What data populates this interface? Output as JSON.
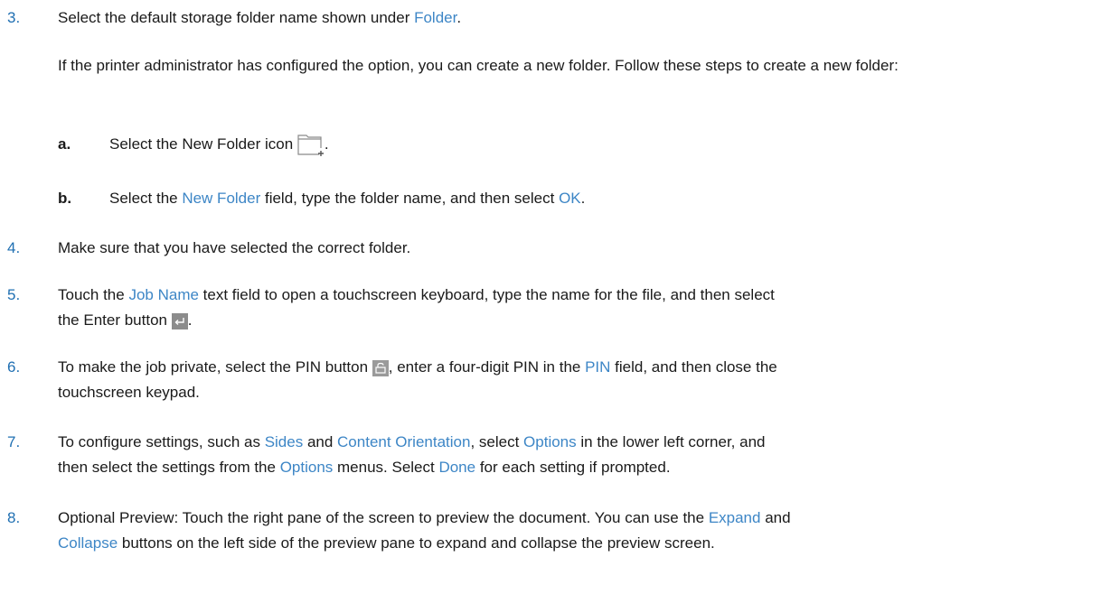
{
  "steps": [
    {
      "number": "3.",
      "parts": {
        "p1": "Select the default storage folder name shown under ",
        "u1": "Folder",
        "p2": "."
      }
    },
    {
      "paragraph": "If the printer administrator has configured the option, you can create a new folder. Follow these steps to create a new folder:"
    },
    {
      "letter": "a.",
      "parts": {
        "p1": "Select the New Folder icon ",
        "p2": "."
      },
      "icon": "new-folder-icon"
    },
    {
      "letter": "b.",
      "parts": {
        "p1": "Select the ",
        "u1": "New Folder",
        "p2": " field, type the folder name, and then select ",
        "u2": "OK",
        "p3": "."
      }
    },
    {
      "number": "4.",
      "parts": {
        "p1": "Make sure that you have selected the correct folder."
      }
    },
    {
      "number": "5.",
      "parts": {
        "p1": "Touch the ",
        "u1": "Job Name",
        "p2": " text field to open a touchscreen keyboard, type the name for the file, and then select",
        "p3": "the Enter button ",
        "p4": "."
      },
      "icon": "enter-icon"
    },
    {
      "number": "6.",
      "parts": {
        "p1": "To make the job private, select the PIN button ",
        "p2": ", enter a four-digit PIN in the ",
        "u1": "PIN",
        "p3": " field, and then close the",
        "p4": "touchscreen keypad."
      },
      "icon": "pin-icon"
    },
    {
      "number": "7.",
      "parts": {
        "p1": "To configure settings, such as ",
        "u1": "Sides",
        "p2": " and ",
        "u2": "Content Orientation",
        "p3": ", select ",
        "u3": "Options",
        "p4": " in the lower left corner, and",
        "p5": "then select the settings from the ",
        "u4": "Options",
        "p6": " menus. Select ",
        "u5": "Done",
        "p7": " for each setting if prompted."
      }
    },
    {
      "number": "8.",
      "parts": {
        "p1": "Optional Preview: Touch the right pane of the screen to preview the document. You can use the ",
        "u1": "Expand",
        "p2": " and",
        "u2": "Collapse",
        "p3": " buttons on the left side of the preview pane to expand and collapse the preview screen."
      }
    }
  ],
  "colors": {
    "number": "#1f6fb2",
    "ui_term": "#3d86c6",
    "text": "#1a1a1a"
  }
}
